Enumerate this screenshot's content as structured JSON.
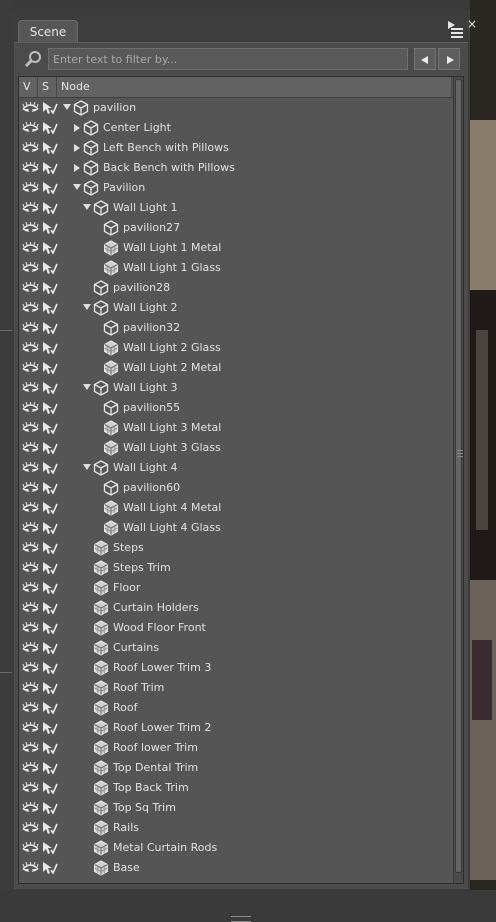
{
  "panel": {
    "tab_label": "Scene",
    "close_glyph": "×",
    "menu_icon": "panel-menu-icon"
  },
  "search": {
    "placeholder": "Enter text to filter by...",
    "value": ""
  },
  "columns": {
    "v": "V",
    "s": "S",
    "node": "Node"
  },
  "icons": {
    "visible": "eye-icon",
    "selectable": "cursor-icon",
    "group": "group-node-icon",
    "object": "mesh-node-icon"
  },
  "colors": {
    "panel_bg": "#4b4b4b",
    "header_bg": "#626262",
    "text": "#e2e2e2"
  },
  "nodes": [
    {
      "label": "pavilion",
      "depth": 0,
      "expander": "open",
      "type": "group"
    },
    {
      "label": "Center Light",
      "depth": 1,
      "expander": "closed",
      "type": "group"
    },
    {
      "label": "Left Bench with Pillows",
      "depth": 1,
      "expander": "closed",
      "type": "group"
    },
    {
      "label": "Back Bench with Pillows",
      "depth": 1,
      "expander": "closed",
      "type": "group"
    },
    {
      "label": "Pavilion",
      "depth": 1,
      "expander": "open",
      "type": "group"
    },
    {
      "label": "Wall Light 1",
      "depth": 2,
      "expander": "open",
      "type": "group"
    },
    {
      "label": "pavilion27",
      "depth": 3,
      "expander": "none",
      "type": "group"
    },
    {
      "label": "Wall Light 1 Metal",
      "depth": 3,
      "expander": "none",
      "type": "object"
    },
    {
      "label": "Wall Light 1 Glass",
      "depth": 3,
      "expander": "none",
      "type": "object"
    },
    {
      "label": "pavilion28",
      "depth": 2,
      "expander": "none",
      "type": "group"
    },
    {
      "label": "Wall Light 2",
      "depth": 2,
      "expander": "open",
      "type": "group"
    },
    {
      "label": "pavilion32",
      "depth": 3,
      "expander": "none",
      "type": "group"
    },
    {
      "label": "Wall Light 2 Glass",
      "depth": 3,
      "expander": "none",
      "type": "object"
    },
    {
      "label": "Wall Light 2 Metal",
      "depth": 3,
      "expander": "none",
      "type": "object"
    },
    {
      "label": "Wall Light 3",
      "depth": 2,
      "expander": "open",
      "type": "group"
    },
    {
      "label": "pavilion55",
      "depth": 3,
      "expander": "none",
      "type": "group"
    },
    {
      "label": "Wall Light 3 Metal",
      "depth": 3,
      "expander": "none",
      "type": "object"
    },
    {
      "label": "Wall Light 3 Glass",
      "depth": 3,
      "expander": "none",
      "type": "object"
    },
    {
      "label": "Wall Light 4",
      "depth": 2,
      "expander": "open",
      "type": "group"
    },
    {
      "label": "pavilion60",
      "depth": 3,
      "expander": "none",
      "type": "group"
    },
    {
      "label": "Wall Light 4 Metal",
      "depth": 3,
      "expander": "none",
      "type": "object"
    },
    {
      "label": "Wall Light 4 Glass",
      "depth": 3,
      "expander": "none",
      "type": "object"
    },
    {
      "label": "Steps",
      "depth": 2,
      "expander": "none",
      "type": "object"
    },
    {
      "label": "Steps Trim",
      "depth": 2,
      "expander": "none",
      "type": "object"
    },
    {
      "label": "Floor",
      "depth": 2,
      "expander": "none",
      "type": "object"
    },
    {
      "label": "Curtain Holders",
      "depth": 2,
      "expander": "none",
      "type": "object"
    },
    {
      "label": "Wood Floor Front",
      "depth": 2,
      "expander": "none",
      "type": "object"
    },
    {
      "label": "Curtains",
      "depth": 2,
      "expander": "none",
      "type": "object"
    },
    {
      "label": "Roof Lower Trim 3",
      "depth": 2,
      "expander": "none",
      "type": "object"
    },
    {
      "label": "Roof Trim",
      "depth": 2,
      "expander": "none",
      "type": "object"
    },
    {
      "label": "Roof",
      "depth": 2,
      "expander": "none",
      "type": "object"
    },
    {
      "label": "Roof Lower Trim 2",
      "depth": 2,
      "expander": "none",
      "type": "object"
    },
    {
      "label": "Roof lower Trim",
      "depth": 2,
      "expander": "none",
      "type": "object"
    },
    {
      "label": "Top Dental Trim",
      "depth": 2,
      "expander": "none",
      "type": "object"
    },
    {
      "label": "Top Back Trim",
      "depth": 2,
      "expander": "none",
      "type": "object"
    },
    {
      "label": "Top Sq Trim",
      "depth": 2,
      "expander": "none",
      "type": "object"
    },
    {
      "label": "Rails",
      "depth": 2,
      "expander": "none",
      "type": "object"
    },
    {
      "label": "Metal Curtain Rods",
      "depth": 2,
      "expander": "none",
      "type": "object"
    },
    {
      "label": "Base",
      "depth": 2,
      "expander": "none",
      "type": "object"
    }
  ]
}
